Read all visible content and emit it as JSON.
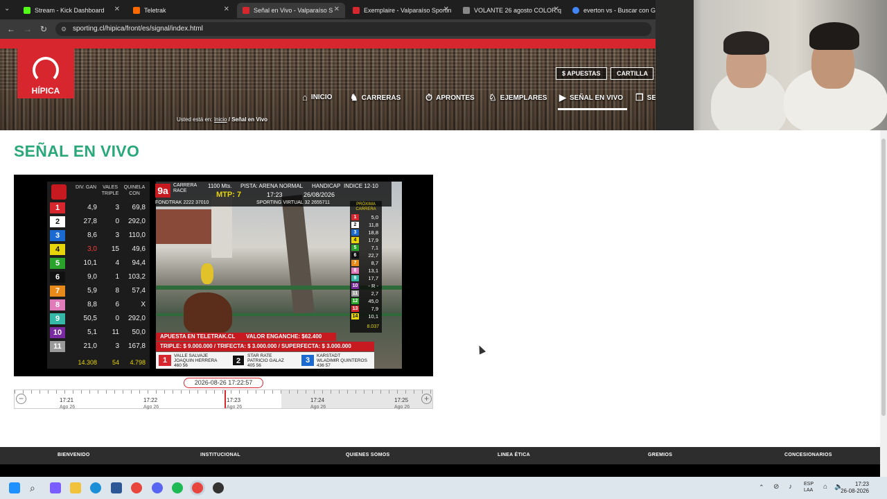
{
  "browser": {
    "tabs": [
      {
        "title": "Stream - Kick Dashboard",
        "color": "#53fc18",
        "active": false
      },
      {
        "title": "Teletrak",
        "color": "#ff6a00",
        "active": false
      },
      {
        "title": "Señal en Vivo - Valparaíso S",
        "color": "#d7262d",
        "active": true
      },
      {
        "title": "Exemplaire - Valparaíso Sportin",
        "color": "#d7262d",
        "active": false
      },
      {
        "title": "VOLANTE 26 agosto COLOR.q",
        "color": "#888888",
        "active": false
      },
      {
        "title": "everton vs - Buscar con Goog",
        "color": "#4285f4",
        "active": false
      }
    ],
    "url": "sporting.cl/hipica/front/es/signal/index.html"
  },
  "header": {
    "logo_label": "HÍPICA",
    "buttons": [
      "APUESTAS",
      "CARTILLA"
    ],
    "menu": [
      "INICIO",
      "CARRERAS",
      "APRONTES",
      "EJEMPLARES",
      "SEÑAL EN VIVO",
      "SE"
    ],
    "breadcrumb_prefix": "Usted está en:",
    "breadcrumb_link": "Inicio",
    "breadcrumb_current": "/ Señal en Vivo"
  },
  "page": {
    "title": "SEÑAL EN VIVO"
  },
  "video": {
    "race_no": "9a",
    "race_label": "CARRERA RACE",
    "distance": "1100 Mts.",
    "track": "PISTA: ARENA NORMAL",
    "handicap": "HANDICAP",
    "index": "INDICE 12-10",
    "mtp": "MTP: 7",
    "time": "17:23",
    "date": "26/08/2026",
    "fondotrak": "FONDTRAK 2222 37010",
    "sporting_virtual": "SPORTING VIRTUAL 32 2655711",
    "odds_headers": [
      "DIV. GAN",
      "VALES TRIPLE",
      "QUINELA CON"
    ],
    "odds": [
      {
        "n": "1",
        "color": "#d7262d",
        "div": "4,9",
        "vales": "3",
        "quinela": "69,8"
      },
      {
        "n": "2",
        "color": "#ffffff",
        "div": "27,8",
        "vales": "0",
        "quinela": "292,0"
      },
      {
        "n": "3",
        "color": "#1b6ad1",
        "div": "8,6",
        "vales": "3",
        "quinela": "110,0"
      },
      {
        "n": "4",
        "color": "#e8d40a",
        "div": "3,0",
        "vales": "15",
        "quinela": "49,6"
      },
      {
        "n": "5",
        "color": "#2aa32a",
        "div": "10,1",
        "vales": "4",
        "quinela": "94,4"
      },
      {
        "n": "6",
        "color": "#111111",
        "div": "9,0",
        "vales": "1",
        "quinela": "103,2"
      },
      {
        "n": "7",
        "color": "#e88a1a",
        "div": "5,9",
        "vales": "8",
        "quinela": "57,4"
      },
      {
        "n": "8",
        "color": "#e07ab8",
        "div": "8,8",
        "vales": "6",
        "quinela": "X"
      },
      {
        "n": "9",
        "color": "#35b8a8",
        "div": "50,5",
        "vales": "0",
        "quinela": "292,0"
      },
      {
        "n": "10",
        "color": "#7a2aa0",
        "div": "5,1",
        "vales": "11",
        "quinela": "50,0"
      },
      {
        "n": "11",
        "color": "#9a9a9a",
        "div": "21,0",
        "vales": "3",
        "quinela": "167,8"
      }
    ],
    "odds_totals": [
      "14.308",
      "54",
      "4.798"
    ],
    "proxima_label": "PRÓXIMA CARRERA",
    "proxima": [
      {
        "n": "1",
        "color": "#d7262d",
        "v": "5,0"
      },
      {
        "n": "2",
        "color": "#ffffff",
        "v": "11,8"
      },
      {
        "n": "3",
        "color": "#1b6ad1",
        "v": "18,8"
      },
      {
        "n": "4",
        "color": "#e8d40a",
        "v": "17,9"
      },
      {
        "n": "5",
        "color": "#2aa32a",
        "v": "7,1"
      },
      {
        "n": "6",
        "color": "#111111",
        "v": "22,7"
      },
      {
        "n": "7",
        "color": "#e88a1a",
        "v": "8,7"
      },
      {
        "n": "8",
        "color": "#e07ab8",
        "v": "13,1"
      },
      {
        "n": "9",
        "color": "#35b8a8",
        "v": "17,7"
      },
      {
        "n": "10",
        "color": "#7a2aa0",
        "v": "- R -"
      },
      {
        "n": "11",
        "color": "#9a9a9a",
        "v": "2,7"
      },
      {
        "n": "12",
        "color": "#2aa32a",
        "v": "45,0"
      },
      {
        "n": "13",
        "color": "#d7262d",
        "v": "7,9"
      },
      {
        "n": "14",
        "color": "#e8d40a",
        "v": "10,1"
      }
    ],
    "proxima_total": "8.037",
    "apuesta": "APUESTA EN TELETRAK.CL",
    "enganche": "VALOR ENGANCHE: $62.400",
    "pozos": "TRIPLE: $ 9.000.000  /  TRIFECTA: $ 3.000.000  /  SUPERFECTA: $ 3.000.000",
    "leaders": [
      {
        "n": "1",
        "name": "VALLE SALVAJE",
        "jockey": "JOAQUIN HERRERA",
        "stats": "460    56"
      },
      {
        "n": "2",
        "name": "STAR RATE",
        "jockey": "PATRICIO GALAZ",
        "stats": "405    56"
      },
      {
        "n": "3",
        "name": "KARSTADT",
        "jockey": "WLADIMIR QUINTEROS",
        "stats": "436    57"
      }
    ]
  },
  "timeline": {
    "current": "2026-08-26 17:22:57",
    "ticks": [
      {
        "time": "17:21",
        "date": "Ago 26"
      },
      {
        "time": "17:22",
        "date": "Ago 26"
      },
      {
        "time": "17:23",
        "date": "Ago 26"
      },
      {
        "time": "17:24",
        "date": "Ago 26"
      },
      {
        "time": "17:25",
        "date": "Ago 26"
      }
    ],
    "zoom_out": "−",
    "zoom_in": "+"
  },
  "footer": {
    "links": [
      "BIENVENIDO",
      "INSTITUCIONAL",
      "QUIENES SOMOS",
      "LINEA ÉTICA",
      "GREMIOS",
      "CONCESIONARIOS"
    ]
  },
  "taskbar": {
    "lang1": "ESP",
    "lang2": "LAA",
    "time": "17:23",
    "date": "26-08-2026"
  }
}
